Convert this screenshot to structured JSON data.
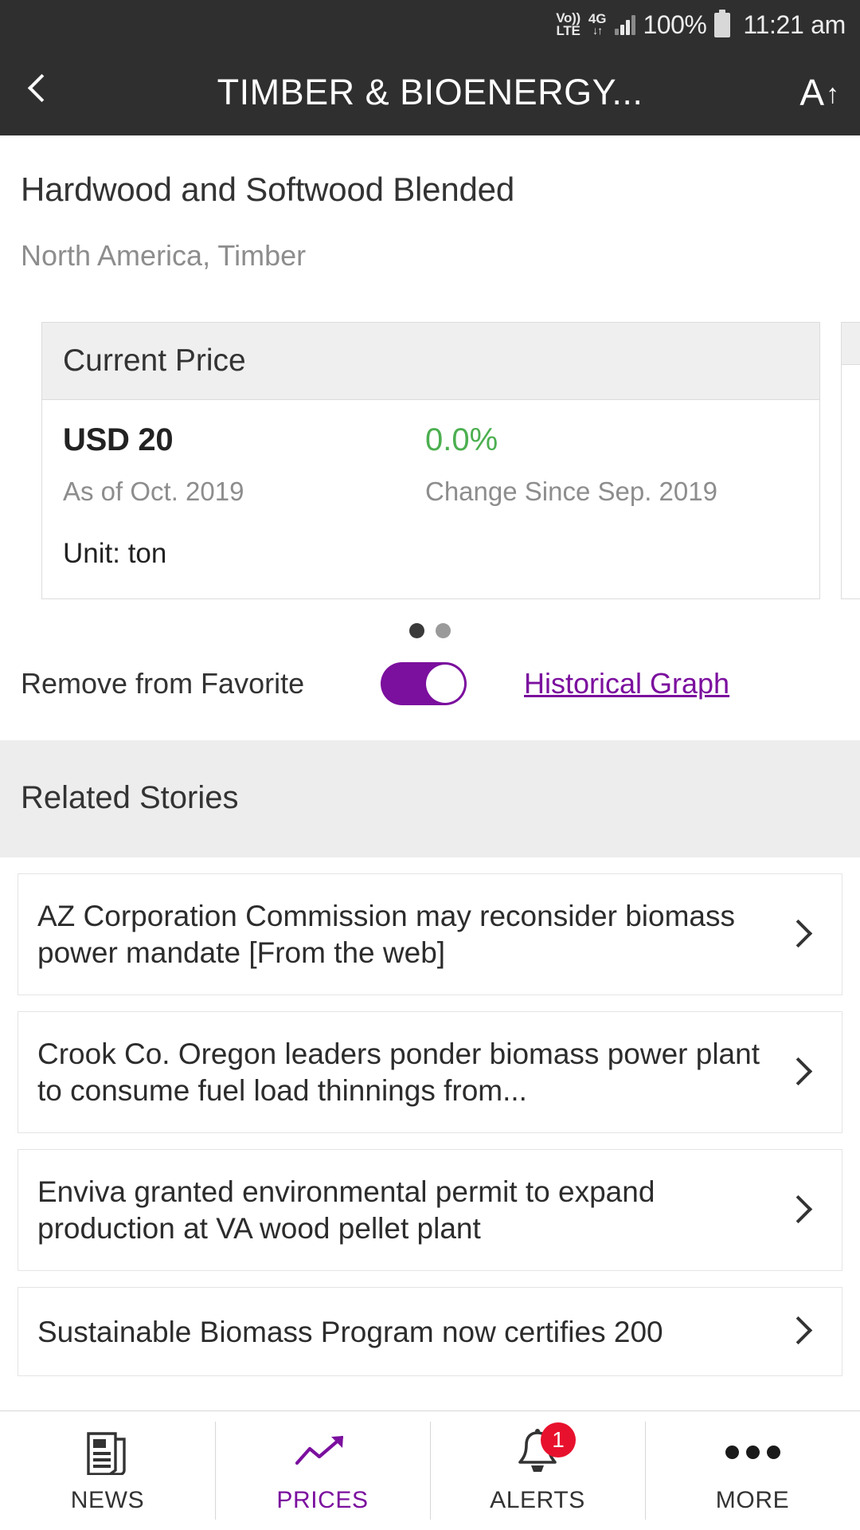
{
  "status_bar": {
    "volte_top": "Vo))",
    "volte_bottom": "LTE",
    "network": "4G",
    "network_arrows": "↓↑",
    "battery_percent": "100%",
    "time": "11:21 am"
  },
  "app_bar": {
    "back_icon": "chevron-left-icon",
    "title": "TIMBER & BIOENERGY...",
    "font_size_letter": "A",
    "font_size_arrow": "↑"
  },
  "commodity": {
    "name": "Hardwood and Softwood Blended",
    "region": "North America, Timber"
  },
  "price_cards": [
    {
      "header": "Current Price",
      "value": "USD 20",
      "value_caption": "As of Oct. 2019",
      "change": "0.0%",
      "change_caption": "Change Since Sep. 2019",
      "unit": "Unit: ton",
      "change_color": "#4caf50"
    },
    {
      "header": "",
      "value": "",
      "value_caption": "",
      "change": "",
      "change_caption": "",
      "unit": "",
      "change_color": "#4caf50"
    }
  ],
  "carousel": {
    "dot_count": 2,
    "active_index": 0,
    "active_color": "#3a3a3a",
    "inactive_color": "#9a9a9a"
  },
  "favorite_row": {
    "label": "Remove from Favorite",
    "toggle_state": "on",
    "toggle_color": "#7b0f9e",
    "link_label": "Historical Graph",
    "link_color": "#7b0f9e"
  },
  "related": {
    "heading": "Related Stories",
    "stories": [
      {
        "title": "AZ Corporation Commission may reconsider biomass power mandate [From the web]"
      },
      {
        "title": "Crook Co. Oregon leaders ponder biomass power plant to consume fuel load thinnings from..."
      },
      {
        "title": "Enviva granted environmental permit to expand production at VA wood pellet plant"
      },
      {
        "title": "Sustainable Biomass Program now certifies 200"
      }
    ],
    "chevron_icon": "chevron-right-icon"
  },
  "bottom_nav": {
    "active_color": "#7b0f9e",
    "inactive_color": "#333333",
    "items": [
      {
        "label": "NEWS",
        "icon": "newspaper-icon",
        "active": false,
        "badge": ""
      },
      {
        "label": "PRICES",
        "icon": "trending-up-icon",
        "active": true,
        "badge": ""
      },
      {
        "label": "ALERTS",
        "icon": "bell-icon",
        "active": false,
        "badge": "1"
      },
      {
        "label": "MORE",
        "icon": "ellipsis-icon",
        "active": false,
        "badge": ""
      }
    ]
  }
}
